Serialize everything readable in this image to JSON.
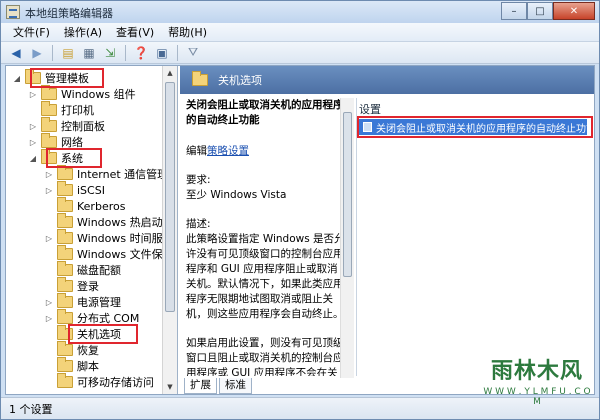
{
  "window": {
    "title": "本地组策略编辑器",
    "minimize": "–",
    "maximize": "□",
    "close": "✕"
  },
  "menubar": {
    "items": [
      "文件(F)",
      "操作(A)",
      "查看(V)",
      "帮助(H)"
    ]
  },
  "toolbar": {
    "icons": [
      "back-icon",
      "forward-icon",
      "up-folder-icon",
      "show-hide-tree-icon",
      "export-list-icon",
      "help-icon",
      "properties-icon",
      "filter-icon"
    ]
  },
  "tree": {
    "items": [
      {
        "label": "管理模板",
        "expander": "◢",
        "level": 0
      },
      {
        "label": "Windows 组件",
        "expander": "▷",
        "level": 1
      },
      {
        "label": "打印机",
        "expander": "",
        "level": 1
      },
      {
        "label": "控制面板",
        "expander": "▷",
        "level": 1
      },
      {
        "label": "网络",
        "expander": "▷",
        "level": 1
      },
      {
        "label": "系统",
        "expander": "◢",
        "level": 1
      },
      {
        "label": "Internet 通信管理",
        "expander": "▷",
        "level": 2
      },
      {
        "label": "iSCSI",
        "expander": "▷",
        "level": 2
      },
      {
        "label": "Kerberos",
        "expander": "",
        "level": 2
      },
      {
        "label": "Windows 热启动",
        "expander": "",
        "level": 2
      },
      {
        "label": "Windows 时间服务",
        "expander": "▷",
        "level": 2
      },
      {
        "label": "Windows 文件保护",
        "expander": "",
        "level": 2
      },
      {
        "label": "磁盘配额",
        "expander": "",
        "level": 2
      },
      {
        "label": "登录",
        "expander": "",
        "level": 2
      },
      {
        "label": "电源管理",
        "expander": "▷",
        "level": 2
      },
      {
        "label": "分布式 COM",
        "expander": "▷",
        "level": 2
      },
      {
        "label": "关机选项",
        "expander": "",
        "level": 2
      },
      {
        "label": "恢复",
        "expander": "",
        "level": 2
      },
      {
        "label": "脚本",
        "expander": "",
        "level": 2
      },
      {
        "label": "可移动存储访问",
        "expander": "",
        "level": 2
      }
    ]
  },
  "panel": {
    "header": "关机选项",
    "desc_title": "关闭会阻止或取消关机的应用程序的自动终止功能",
    "edit_prefix": "编辑",
    "edit_link": "策略设置",
    "requirements_label": "要求:",
    "requirements_value": "至少 Windows Vista",
    "description_label": "描述:",
    "description_text": "此策略设置指定 Windows 是否允许没有可见顶级窗口的控制台应用程序和 GUI 应用程序阻止或取消关机。默认情况下，如果此类应用程序无限期地试图取消或阻止关机，则这些应用程序会自动终止。",
    "description_text2": "如果启用此设置，则没有可见顶级窗口且阻止或取消关机的控制台应用程序或 GUI 应用程序不会在关机期间自动终止。",
    "settings_header": "设置",
    "settings_item": "关闭会阻止或取消关机的应用程序的自动终止功能",
    "tabs": [
      "扩展",
      "标准"
    ]
  },
  "statusbar": {
    "text": "1 个设置"
  },
  "watermark": {
    "text": "雨林木风",
    "url": "W W W . Y L M F U . C O M"
  },
  "colors": {
    "highlight": "#e0262e",
    "selection": "#3a78d6",
    "header": "#4c6fa3"
  }
}
